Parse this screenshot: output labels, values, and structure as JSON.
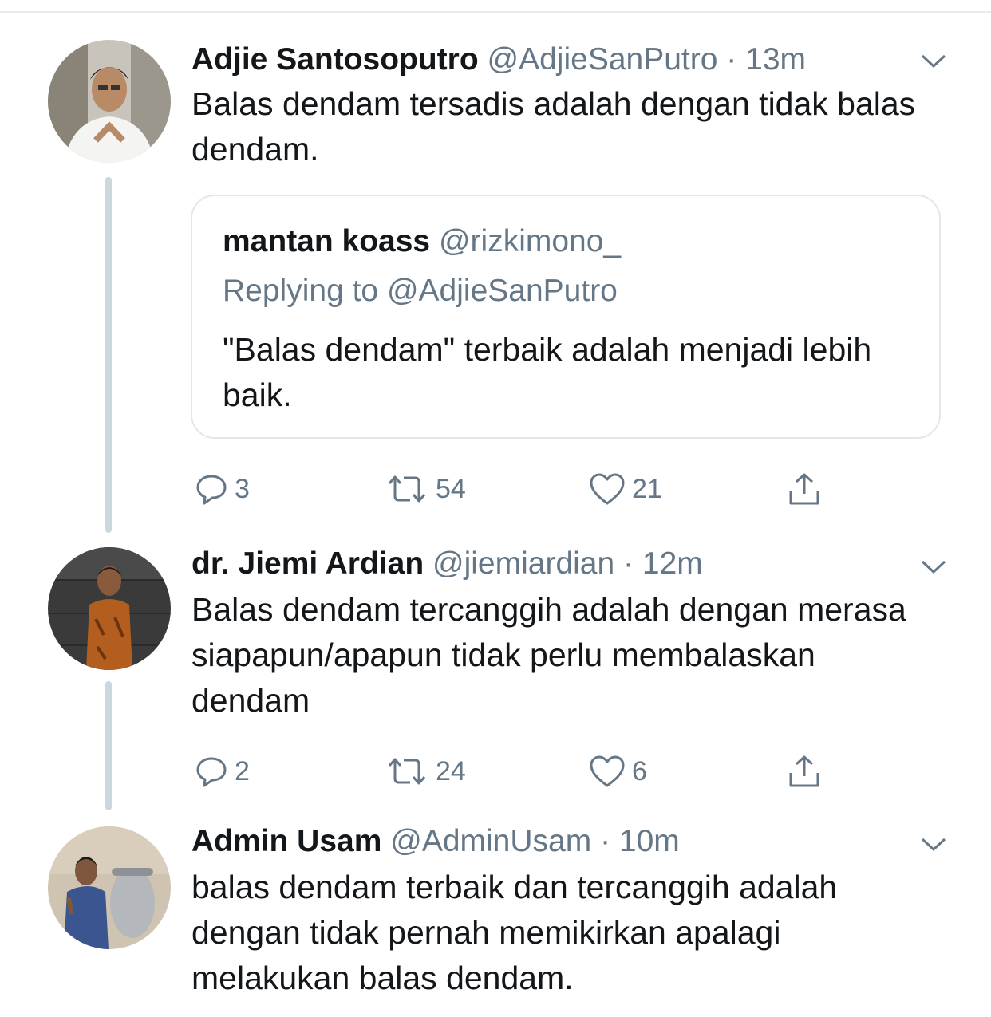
{
  "tweets": [
    {
      "name": "Adjie Santosoputro",
      "handle": "@AdjieSanPutro",
      "dot": "·",
      "time": "13m",
      "text": "Balas dendam tersadis adalah dengan tidak balas dendam.",
      "quote": {
        "name": "mantan koass",
        "handle": "@rizkimono_",
        "reply": "Replying to @AdjieSanPutro",
        "text": "\"Balas dendam\" terbaik adalah menjadi lebih baik."
      },
      "replies": "3",
      "retweets": "54",
      "likes": "21"
    },
    {
      "name": "dr. Jiemi Ardian",
      "handle": "@jiemiardian",
      "dot": "·",
      "time": "12m",
      "text": "Balas dendam tercanggih adalah dengan merasa siapapun/apapun tidak perlu membalaskan dendam",
      "replies": "2",
      "retweets": "24",
      "likes": "6"
    },
    {
      "name": "Admin Usam",
      "handle": "@AdminUsam",
      "dot": "·",
      "time": "10m",
      "text": "balas dendam terbaik dan tercanggih adalah dengan tidak pernah memikirkan apalagi melakukan balas dendam."
    }
  ],
  "colors": {
    "primary_text": "#14171a",
    "secondary_text": "#657786",
    "thread_line": "#ccd6dd",
    "border": "#e1e8ed"
  },
  "icons": [
    "reply-icon",
    "retweet-icon",
    "like-icon",
    "share-icon",
    "chevron-down-icon"
  ]
}
